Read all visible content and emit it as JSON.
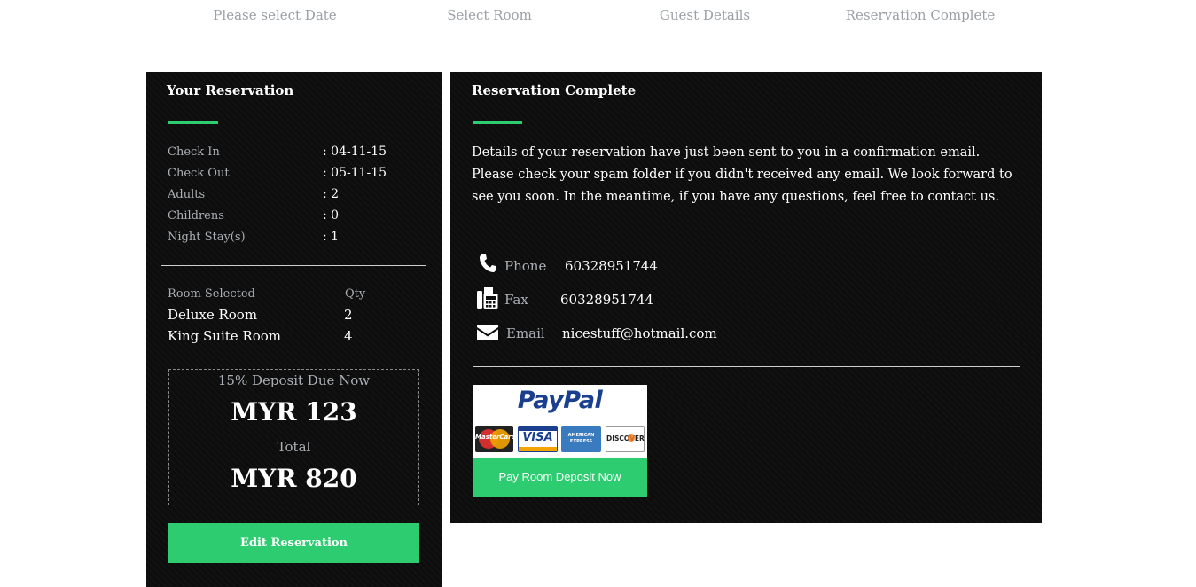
{
  "steps": [
    "Please select Date",
    "Select Room",
    "Guest Details",
    "Reservation Complete"
  ],
  "reservation": {
    "title": "Your Reservation",
    "check_in_label": "Check In",
    "check_in_value": ": 04-11-15",
    "check_out_label": "Check Out",
    "check_out_value": ": 05-11-15",
    "adults_label": "Adults",
    "adults_value": ": 2",
    "children_label": "Childrens",
    "children_value": ": 0",
    "nights_label": "Night Stay(s)",
    "nights_value": ": 1",
    "room_header": "Room Selected",
    "qty_header": "Qty",
    "rooms": [
      {
        "name": "Deluxe Room",
        "qty": "2"
      },
      {
        "name": "King Suite Room",
        "qty": "4"
      }
    ],
    "deposit_label": "15% Deposit Due Now",
    "deposit_amount": "MYR 123",
    "total_label": "Total",
    "total_amount": "MYR 820",
    "edit_button": "Edit Reservation"
  },
  "complete": {
    "title": "Reservation Complete",
    "message": "Details of your reservation have just been sent to you in a confirmation email. Please check your spam folder if you didn't received any email. We look forward to see you soon. In the meantime, if you have any questions, feel free to contact us.",
    "phone_label": "Phone",
    "phone_value": "60328951744",
    "fax_label": "Fax",
    "fax_value": "60328951744",
    "email_label": "Email",
    "email_value": "nicestuff@hotmail.com",
    "paypal_logo": "PayPal",
    "cards": [
      "MasterCard",
      "VISA",
      "AMERICAN EXPRESS",
      "DISCOVER"
    ],
    "pay_button": "Pay Room Deposit Now"
  },
  "colors": {
    "accent": "#2ecc71",
    "panel": "#0d0d0d"
  },
  "icons": {
    "phone": "phone-icon",
    "fax": "fax-icon",
    "email": "envelope-icon"
  }
}
